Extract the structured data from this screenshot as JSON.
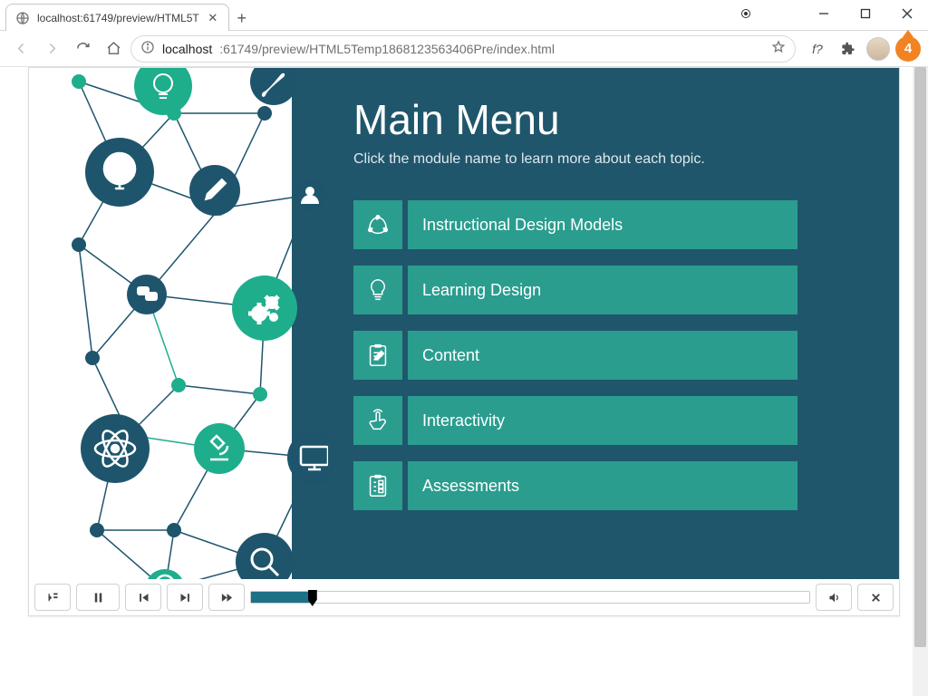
{
  "window": {
    "tabTitle": "localhost:61749/preview/HTML5T",
    "notifCount": "4"
  },
  "address": {
    "host": "localhost",
    "rest": ":61749/preview/HTML5Temp1868123563406Pre/index.html"
  },
  "page": {
    "title": "Main Menu",
    "subtitle": "Click the module name to learn more about each topic."
  },
  "modules": [
    {
      "label": "Instructional Design Models",
      "icon": "cycle"
    },
    {
      "label": "Learning Design",
      "icon": "bulb"
    },
    {
      "label": "Content",
      "icon": "clipboard-edit"
    },
    {
      "label": "Interactivity",
      "icon": "touch"
    },
    {
      "label": "Assessments",
      "icon": "clipboard-check"
    }
  ],
  "playbar": {
    "progressPct": 11
  }
}
